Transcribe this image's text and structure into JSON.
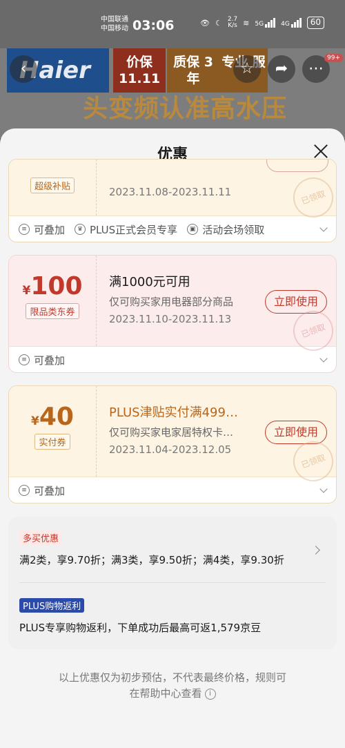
{
  "status": {
    "carrier1": "中国联通",
    "carrier2": "中国移动",
    "time": "03:06",
    "speed_value": "2.7",
    "speed_unit": "K/s",
    "net1": "5G",
    "net2": "4G",
    "battery": "60"
  },
  "banner": {
    "logo": "Haier",
    "tile1": "价保 11.11",
    "tile2": "质保 3年",
    "tile3": "专业 服",
    "slogan": "头变频认准高水压",
    "badge": "99+"
  },
  "sheet": {
    "title": "优惠",
    "coupons": [
      {
        "tag": "超级补贴",
        "date": "2023.11.08-2023.11.11",
        "stamp": "已领取",
        "features": [
          "可叠加",
          "PLUS正式会员专享",
          "活动会场领取"
        ]
      },
      {
        "yen": "¥",
        "amount": "100",
        "tag": "限品类东券",
        "title": "满1000元可用",
        "sub": "仅可购买家用电器部分商品",
        "date": "2023.11.10-2023.11.13",
        "button": "立即使用",
        "stamp": "已领取",
        "features": [
          "可叠加"
        ]
      },
      {
        "yen": "¥",
        "amount": "40",
        "tag": "实付券",
        "title": "PLUS津贴实付满499…",
        "sub": "仅可购买家电家居特权卡…",
        "date": "2023.11.04-2023.12.05",
        "button": "立即使用",
        "stamp": "已领取",
        "features": [
          "可叠加"
        ]
      }
    ],
    "multi": {
      "badge": "多买优惠",
      "text": "满2类，享9.70折；满3类，享9.50折；满4类，享9.30折"
    },
    "plus": {
      "badge": "PLUS购物返利",
      "text": "PLUS专享购物返利，下单成功后最高可返1,579京豆"
    },
    "footnote_line1": "以上优惠仅为初步预估，不代表最终价格，规则可",
    "footnote_line2": "在帮助中心查看"
  },
  "colors": {
    "accent_red": "#c0392b",
    "accent_gold": "#b8661b",
    "plus_blue": "#2c4aa8"
  }
}
